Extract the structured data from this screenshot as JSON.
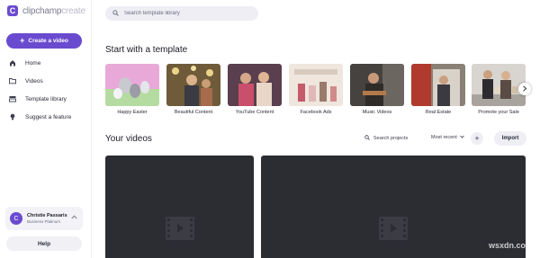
{
  "brand": {
    "mark": "C",
    "name_main": "clipchamp",
    "name_suffix": "create"
  },
  "sidebar": {
    "create_button": {
      "icon": "plus-icon",
      "label": "Create a video"
    },
    "items": [
      {
        "label": "Home",
        "icon": "home-icon"
      },
      {
        "label": "Videos",
        "icon": "folder-icon"
      },
      {
        "label": "Template library",
        "icon": "library-icon"
      },
      {
        "label": "Suggest a feature",
        "icon": "lightbulb-icon"
      }
    ],
    "user": {
      "initial": "C",
      "name": "Christie Passaris",
      "plan": "Business Platinum"
    },
    "help_label": "Help"
  },
  "search": {
    "placeholder": "Search template library"
  },
  "templates_section": {
    "title": "Start with a template",
    "templates": [
      {
        "label": "Happy Easter"
      },
      {
        "label": "Beautiful Content"
      },
      {
        "label": "YouTube Content"
      },
      {
        "label": "Facebook Ads"
      },
      {
        "label": "Music Videos"
      },
      {
        "label": "Real Estate"
      },
      {
        "label": "Promote your Sale"
      }
    ]
  },
  "videos_section": {
    "title": "Your videos",
    "search_projects": "Search projects",
    "sort_label": "Most recent",
    "add_label": "+",
    "import_label": "Import"
  },
  "watermark": "wsxdn.com",
  "colors": {
    "accent": "#6a4bd0",
    "video_bg": "#2c2c33"
  }
}
